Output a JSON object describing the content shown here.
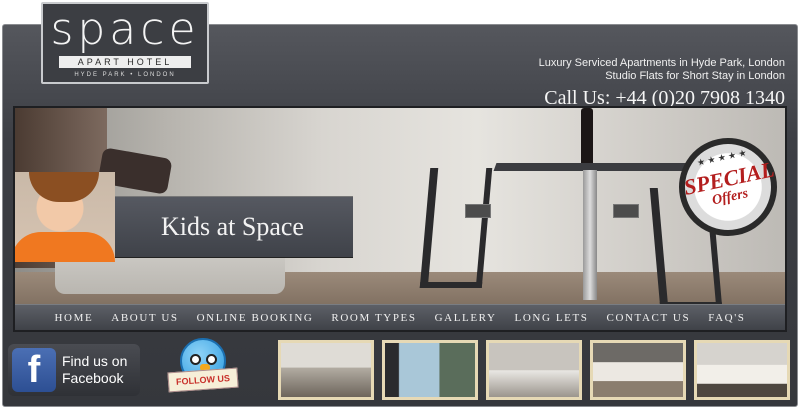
{
  "logo": {
    "name": "space",
    "subtitle": "APART HOTEL",
    "location": "HYDE PARK • LONDON"
  },
  "header": {
    "tagline_1": "Luxury Serviced Apartments in Hyde Park, London",
    "tagline_2": "Studio Flats for Short Stay in London",
    "phone": "Call Us: +44 (0)20 7908 1340"
  },
  "banner": {
    "title": "Kids at Space",
    "badge_main": "SPECIAL",
    "badge_sub": "Offers"
  },
  "nav": {
    "items": [
      "HOME",
      "ABOUT US",
      "ONLINE BOOKING",
      "ROOM TYPES",
      "GALLERY",
      "LONG LETS",
      "CONTACT US",
      "FAQ'S"
    ]
  },
  "social": {
    "facebook_icon": "f",
    "facebook_label_1": "Find us on",
    "facebook_label_2": "Facebook",
    "twitter_label": "FOLLOW US"
  }
}
